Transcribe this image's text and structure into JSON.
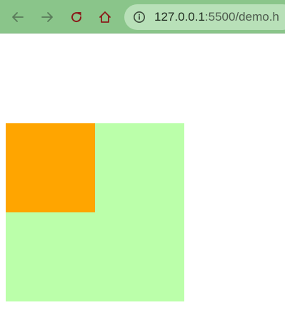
{
  "browser": {
    "toolbar_color": "#8ac58a",
    "icon_color": "#5a7a5a",
    "active_icon_color": "#8b1a1a",
    "buttons": [
      {
        "name": "back",
        "icon": "arrow-left-icon"
      },
      {
        "name": "forward",
        "icon": "arrow-right-icon"
      },
      {
        "name": "reload",
        "icon": "reload-icon"
      },
      {
        "name": "home",
        "icon": "home-icon"
      }
    ],
    "address_bar": {
      "icon": "info-icon",
      "host": "127.0.0.1",
      "path": ":5500/demo.h"
    }
  },
  "page": {
    "background": "#ffffff",
    "outer_box": {
      "color": "#bbffaa"
    },
    "inner_box": {
      "color": "#ffa500"
    }
  }
}
